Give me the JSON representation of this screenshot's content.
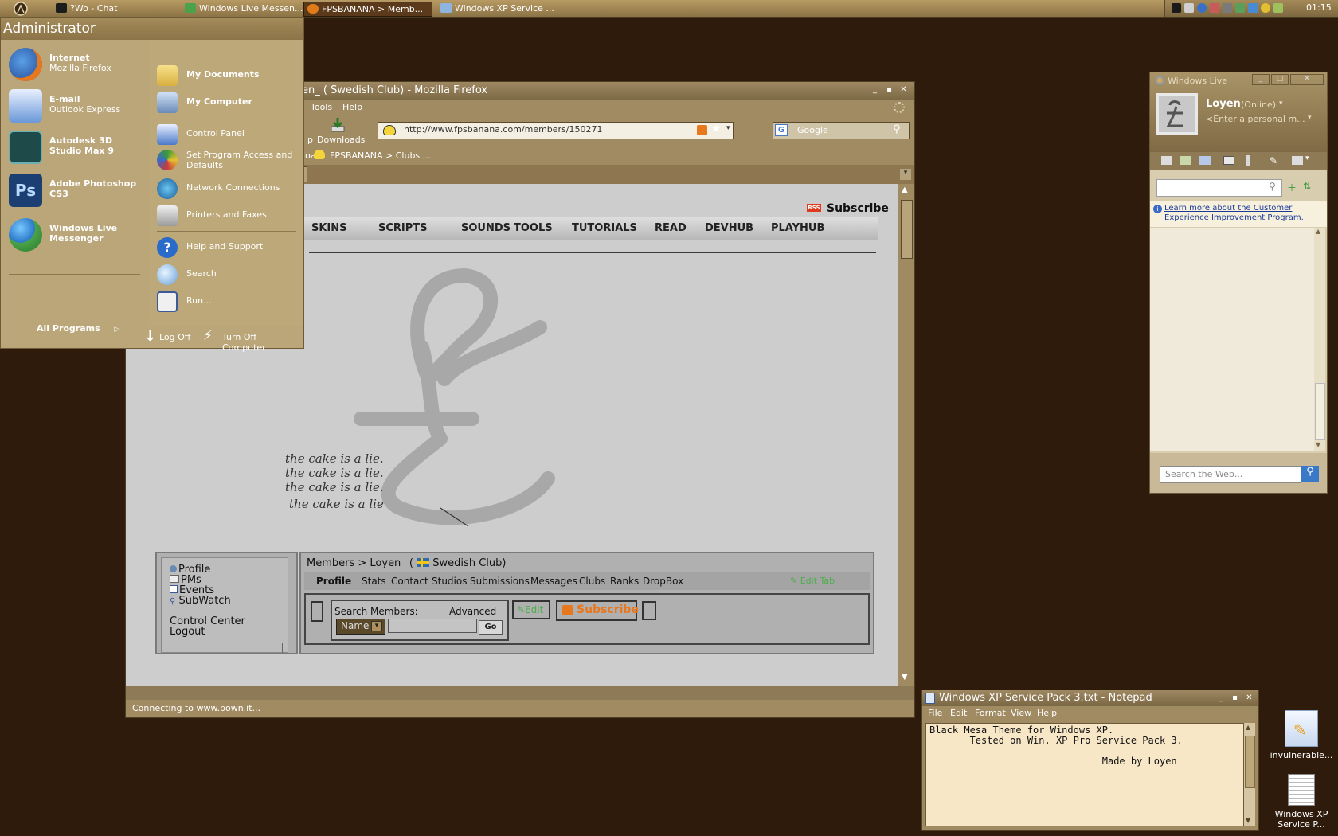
{
  "taskbar": {
    "tasks": [
      {
        "label": "?Wo - Chat"
      },
      {
        "label": "Windows Live Messen..."
      },
      {
        "label": "FPSBANANA > Memb..."
      },
      {
        "label": "Windows XP Service ..."
      }
    ],
    "clock": "01:15"
  },
  "start_menu": {
    "user": "Administrator",
    "pinned": [
      {
        "title": "Internet",
        "subtitle": "Mozilla Firefox",
        "icon": "firefox-icon"
      },
      {
        "title": "E-mail",
        "subtitle": "Outlook Express",
        "icon": "email-icon"
      },
      {
        "title": "Autodesk 3D Studio Max 9",
        "subtitle": "",
        "icon": "3dsmax-icon"
      },
      {
        "title": "Adobe Photoshop CS3",
        "subtitle": "",
        "icon": "photoshop-icon"
      },
      {
        "title": "Windows Live Messenger",
        "subtitle": "",
        "icon": "messenger-icon"
      }
    ],
    "all_programs": "All Programs",
    "right": [
      {
        "label": "My Documents",
        "bold": true
      },
      {
        "label": "My Computer",
        "bold": true
      },
      {
        "label": "Control Panel",
        "bold": false
      },
      {
        "label": "Set Program Access and Defaults",
        "bold": false
      },
      {
        "label": "Network Connections",
        "bold": false
      },
      {
        "label": "Printers and Faxes",
        "bold": false
      },
      {
        "label": "Help and Support",
        "bold": false
      },
      {
        "label": "Search",
        "bold": false
      },
      {
        "label": "Run...",
        "bold": false
      }
    ],
    "log_off": "Log Off",
    "turn_off": "Turn Off Computer"
  },
  "firefox": {
    "title": "en_ ( Swedish Club) - Mozilla Firefox",
    "menu": [
      "Tools",
      "Help"
    ],
    "downloads": "Downloads",
    "url": "http://www.fpsbanana.com/members/150271",
    "search_placeholder": "Google",
    "bookmarks": [
      "Upload",
      "FPSBANANA > Clubs ..."
    ],
    "status": "Connecting to www.pown.it..."
  },
  "site": {
    "rss_badge": "RSS",
    "subscribe": "Subscribe",
    "nav": [
      "SKINS",
      "SCRIPTS",
      "SOUNDS",
      "TOOLS",
      "TUTORIALS",
      "READ",
      "DEVHUB",
      "PLAYHUB"
    ],
    "handwriting": [
      "the cake is a lie.",
      "the cake is a lie.",
      "the cake is a lie.",
      "the cake is a lie"
    ],
    "sidebar": [
      "Profile",
      "PMs",
      "Events",
      "SubWatch",
      "Control Center",
      "Logout"
    ],
    "breadcrumb": "Members > Loyen_ (",
    "breadcrumb_club": "Swedish Club)",
    "tabs": [
      "Profile",
      "Stats",
      "Contact",
      "Studios",
      "Submissions",
      "Messages",
      "Clubs",
      "Ranks",
      "DropBox"
    ],
    "edit_tab": "Edit Tab",
    "search_members": "Search Members:",
    "advanced": "Advanced",
    "name_option": "Name",
    "go": "Go",
    "edit": "Edit",
    "subscribe_btn": "Subscribe"
  },
  "messenger": {
    "title": "Windows Live",
    "name": "Loyen",
    "status": "(Online)",
    "personal_message": "<Enter a personal m...",
    "info_link": "Learn more about the Customer Experience Improvement Program.",
    "web_search_placeholder": "Search the Web..."
  },
  "notepad": {
    "title": "Windows XP Service Pack 3.txt - Notepad",
    "menu": [
      "File",
      "Edit",
      "Format",
      "View",
      "Help"
    ],
    "text": "Black Mesa Theme for Windows XP.\n       Tested on Win. XP Pro Service Pack 3.\n\n                              Made by Loyen"
  },
  "desktop_icons": [
    {
      "label": "invulnerable...",
      "icon": "pencil-file-icon"
    },
    {
      "label": "Windows XP Service P...",
      "icon": "text-file-icon"
    }
  ],
  "colors": {
    "desktop": "#2e1b0c",
    "theme_tan": "#a08b62",
    "rss_orange": "#e8781e",
    "notepad_bg": "#f8e7c7"
  }
}
